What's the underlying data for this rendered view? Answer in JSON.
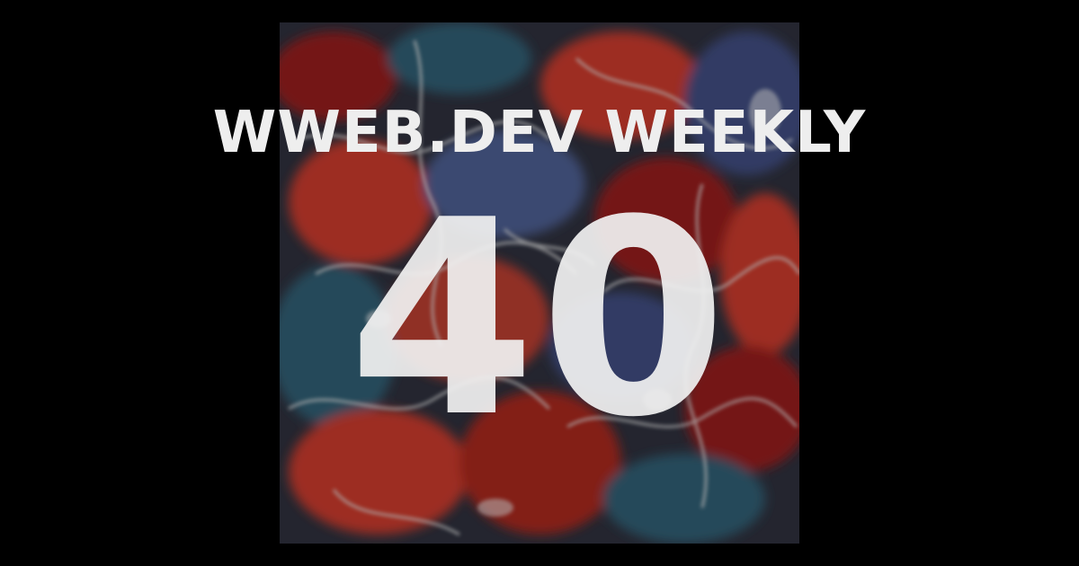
{
  "cover": {
    "title": "WWEB.DEV WEEKLY",
    "issue_number": "40"
  },
  "colors": {
    "background": "#000000",
    "text": "#eeeeee",
    "art_palette": [
      "#2a2a33",
      "#c0392b",
      "#8e1f1a",
      "#2e5a6e",
      "#4a5a8a",
      "#d8d8d8",
      "#1a1a22"
    ]
  }
}
